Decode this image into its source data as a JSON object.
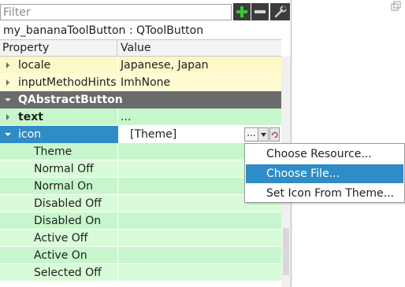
{
  "filter": {
    "placeholder": "Filter",
    "value": ""
  },
  "toolbar": {
    "add_icon": "plus-icon",
    "remove_icon": "minus-icon",
    "config_icon": "wrench-icon"
  },
  "object": {
    "label": "my_bananaToolButton : QToolButton"
  },
  "header": {
    "property": "Property",
    "value": "Value"
  },
  "rows": [
    {
      "name": "locale",
      "value": "Japanese, Japan",
      "expander": "collapsed"
    },
    {
      "name": "inputMethodHints",
      "value": "ImhNone",
      "expander": "collapsed"
    },
    {
      "name": "QAbstractButton",
      "value": "",
      "expander": "expanded"
    },
    {
      "name": "text",
      "value": "...",
      "expander": "collapsed"
    },
    {
      "name": "icon",
      "value": "[Theme]",
      "expander": "expanded"
    },
    {
      "name": "Theme",
      "value": ""
    },
    {
      "name": "Normal Off",
      "value": ""
    },
    {
      "name": "Normal On",
      "value": ""
    },
    {
      "name": "Disabled Off",
      "value": ""
    },
    {
      "name": "Disabled On",
      "value": ""
    },
    {
      "name": "Active Off",
      "value": ""
    },
    {
      "name": "Active On",
      "value": ""
    },
    {
      "name": "Selected Off",
      "value": ""
    }
  ],
  "icon_editor": {
    "dots_label": "...",
    "dropdown_icon": "chevron-down-icon",
    "reset_icon": "reset-arrow-icon"
  },
  "menu": {
    "items": [
      {
        "label": "Choose Resource...",
        "active": false
      },
      {
        "label": "Choose File...",
        "active": true
      },
      {
        "label": "Set Icon From Theme...",
        "active": false
      }
    ]
  },
  "colors": {
    "selection": "#308cc6",
    "group_header": "#6b6b6b",
    "yellow_row": "#fdf8c8",
    "green_row": "#c8f6cc"
  }
}
